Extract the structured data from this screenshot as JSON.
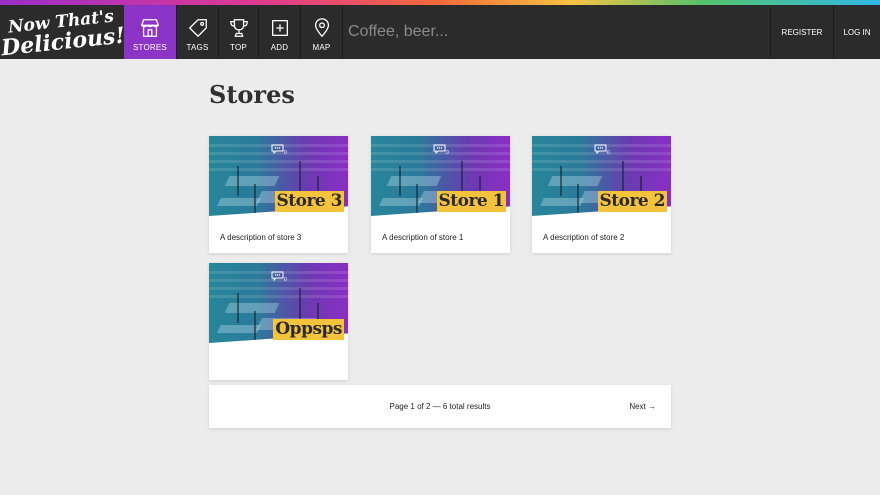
{
  "brand": {
    "line1": "Now That's",
    "line2": "Delicious!"
  },
  "nav": {
    "items": [
      {
        "label": "STORES",
        "icon": "store-icon",
        "active": true
      },
      {
        "label": "TAGS",
        "icon": "tag-icon"
      },
      {
        "label": "TOP",
        "icon": "trophy-icon"
      },
      {
        "label": "ADD",
        "icon": "add-icon"
      },
      {
        "label": "MAP",
        "icon": "map-pin-icon"
      }
    ],
    "search_placeholder": "Coffee, beer...",
    "register": "REGISTER",
    "login": "LOG IN"
  },
  "page": {
    "title": "Stores"
  },
  "stores": [
    {
      "name": "Store 3",
      "description": "A description of store 3",
      "comment_count": "0"
    },
    {
      "name": "Store 1",
      "description": "A description of store 1",
      "comment_count": "0"
    },
    {
      "name": "Store 2",
      "description": "A description of store 2",
      "comment_count": "0"
    },
    {
      "name": "Oppsps",
      "description": "",
      "comment_count": "0"
    }
  ],
  "pagination": {
    "text": "Page 1 of 2 — 6 total results",
    "next": "Next →"
  },
  "colors": {
    "accent": "#8d34c8",
    "nav_bg": "#2b2b2b",
    "label_bg": "#f4c33c",
    "page_bg": "#ececec"
  }
}
